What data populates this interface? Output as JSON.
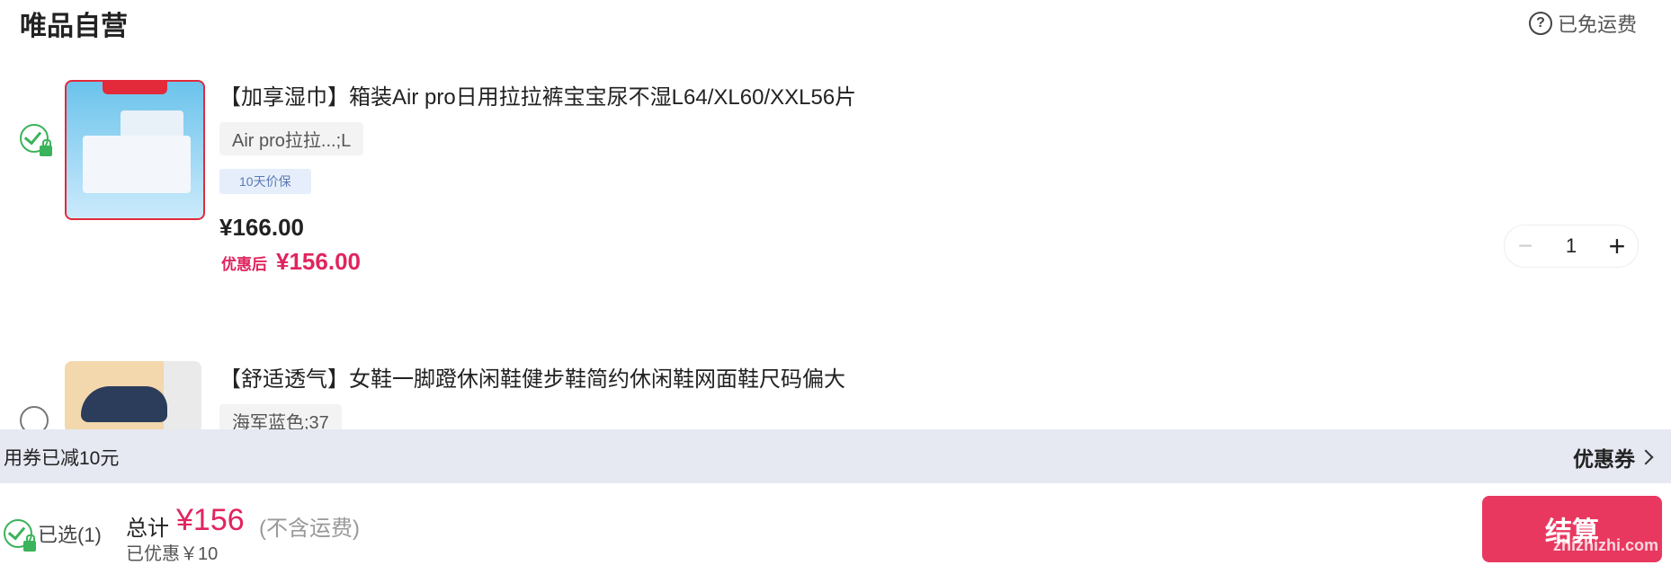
{
  "header": {
    "title": "唯品自营",
    "shipping_label": "已免运费"
  },
  "items": [
    {
      "title": "【加享湿巾】箱装Air pro日用拉拉裤宝宝尿不湿L64/XL60/XXL56片",
      "spec": "Air pro拉拉...;L",
      "tag": "10天价保",
      "price": "¥166.00",
      "after_label": "优惠后",
      "after_price": "¥156.00",
      "quantity": "1",
      "selected": true
    },
    {
      "title": "【舒适透气】女鞋一脚蹬休闲鞋健步鞋简约休闲鞋网面鞋尺码偏大",
      "spec": "海军蓝色;37",
      "selected": false
    }
  ],
  "coupon": {
    "text": "用券已减10元",
    "link_label": "优惠券"
  },
  "footer": {
    "selected_label": "已选(1)",
    "total_label": "总计",
    "total_value": "¥156",
    "total_note": "(不含运费)",
    "saved_label": "已优惠￥10",
    "checkout_label": "结算",
    "watermark": "zhizhizhi.com"
  },
  "colors": {
    "accent": "#e0245e",
    "check": "#3bb35a",
    "checkout": "#e8385f",
    "coupon_bar": "#e6e8f2"
  }
}
